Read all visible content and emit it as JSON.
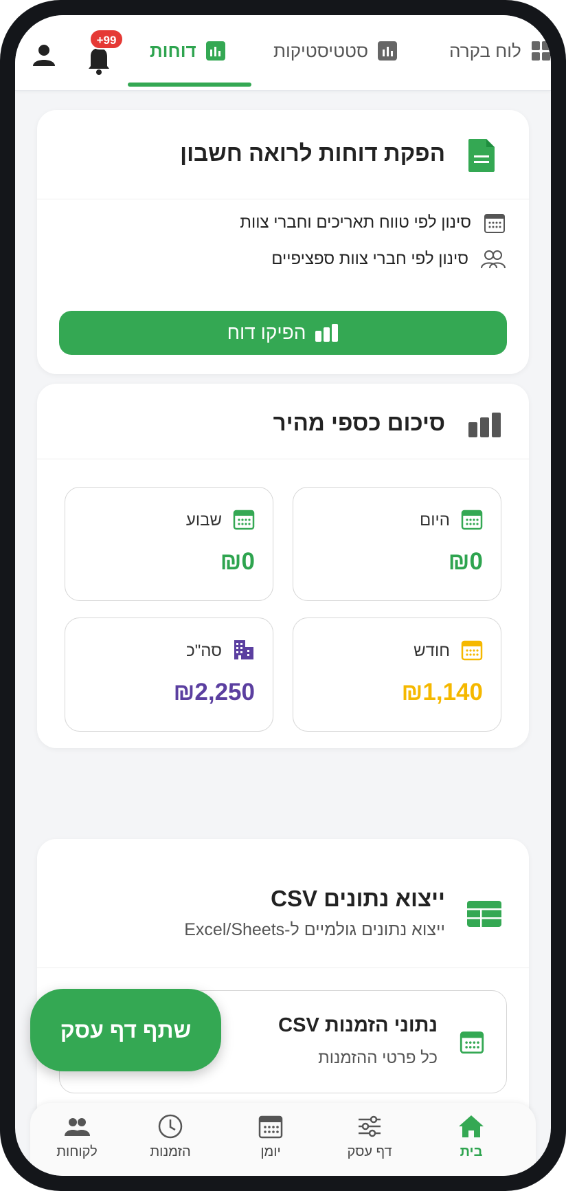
{
  "header": {
    "notifications_badge": "+99",
    "tabs": [
      {
        "label": "דוחות",
        "active": true
      },
      {
        "label": "סטטיסטיקות",
        "active": false
      },
      {
        "label": "לוח בקרה",
        "active": false
      }
    ]
  },
  "reports_card": {
    "title": "הפקת דוחות לרואה חשבון",
    "features": [
      "סינון לפי טווח תאריכים וחברי צוות",
      "סינון לפי חברי צוות ספציפיים"
    ],
    "button_label": "הפיקו דוח"
  },
  "summary_card": {
    "title": "סיכום כספי מהיר",
    "stats": [
      {
        "label": "היום",
        "value": "₪0",
        "color": "#2ea44f"
      },
      {
        "label": "שבוע",
        "value": "₪0",
        "color": "#2ea44f"
      },
      {
        "label": "חודש",
        "value": "₪1,140",
        "color": "#f5b800"
      },
      {
        "label": "סה\"כ",
        "value": "₪2,250",
        "color": "#5b3fa0"
      }
    ]
  },
  "export_card": {
    "title": "ייצוא נתונים CSV",
    "subtitle": "ייצוא נתונים גולמיים ל-Excel/Sheets",
    "items": [
      {
        "title": "נתוני הזמנות CSV",
        "subtitle": "כל פרטי ההזמנות"
      }
    ]
  },
  "fab": {
    "label": "שתף דף עסק"
  },
  "bottom_nav": [
    {
      "label": "בית",
      "active": true
    },
    {
      "label": "דף עסק",
      "active": false
    },
    {
      "label": "יומן",
      "active": false
    },
    {
      "label": "הזמנות",
      "active": false
    },
    {
      "label": "לקוחות",
      "active": false
    }
  ],
  "colors": {
    "brand_green": "#34a853",
    "badge_red": "#e53935",
    "month_yellow": "#f5b800",
    "total_purple": "#5b3fa0"
  }
}
